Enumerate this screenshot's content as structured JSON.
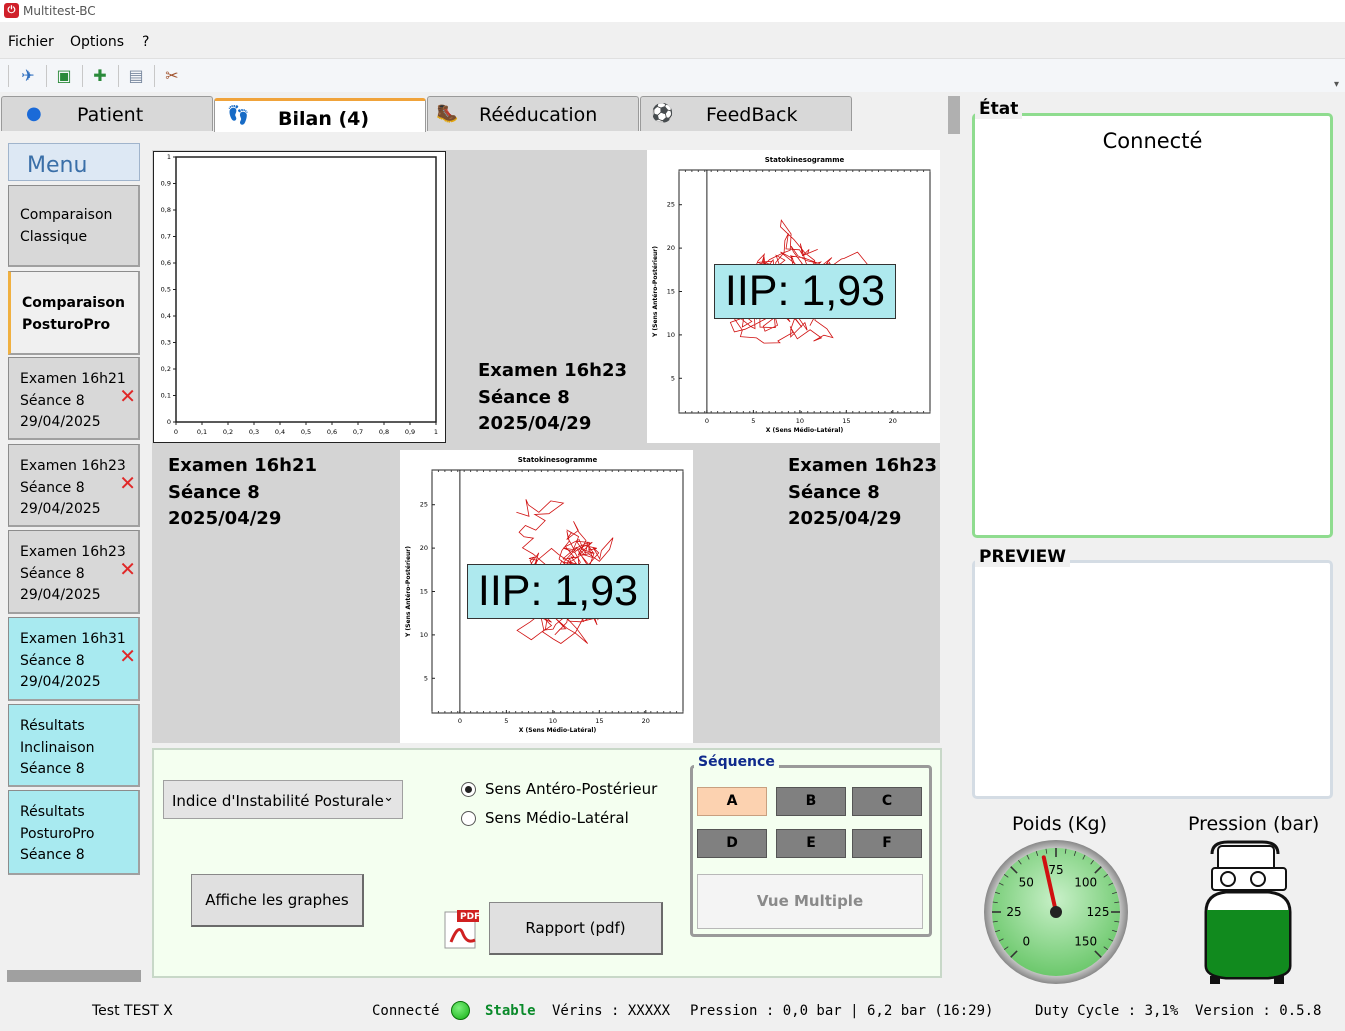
{
  "window": {
    "title": "Multitest-BC"
  },
  "menu": {
    "items": [
      "Fichier",
      "Options",
      "?"
    ]
  },
  "toolbar": {
    "icons": [
      "reset-icon",
      "import-icon",
      "add-patient-icon",
      "open-folder-icon",
      "tools-icon"
    ]
  },
  "tabs": [
    {
      "label": "Patient",
      "icon": "user-icon"
    },
    {
      "label": "Bilan (4)",
      "icon": "feet-icon",
      "active": true
    },
    {
      "label": "Rééducation",
      "icon": "boot-icon"
    },
    {
      "label": "FeedBack",
      "icon": "ball-icon"
    }
  ],
  "sidebar": {
    "title": "Menu",
    "items": [
      {
        "lines": [
          "Comparaison",
          "Classique"
        ],
        "style": "gray"
      },
      {
        "lines": [
          "Comparaison",
          "PosturoPro"
        ],
        "style": "selected"
      },
      {
        "lines": [
          "Examen 16h21",
          "Séance 8",
          "29/04/2025"
        ],
        "style": "gray",
        "delete": true
      },
      {
        "lines": [
          "Examen 16h23",
          "Séance 8",
          "29/04/2025"
        ],
        "style": "gray",
        "delete": true
      },
      {
        "lines": [
          "Examen 16h23",
          "Séance 8",
          "29/04/2025"
        ],
        "style": "gray",
        "delete": true
      },
      {
        "lines": [
          "Examen 16h31",
          "Séance 8",
          "29/04/2025"
        ],
        "style": "cyan",
        "delete": true
      },
      {
        "lines": [
          "Résultats",
          "Inclinaison",
          "Séance 8"
        ],
        "style": "cyan"
      },
      {
        "lines": [
          "Résultats",
          "PosturoPro",
          "Séance 8"
        ],
        "style": "cyan"
      }
    ]
  },
  "grid": {
    "empty_plot": {
      "ticks_x": [
        "0",
        "0,1",
        "0,2",
        "0,3",
        "0,4",
        "0,5",
        "0,6",
        "0,7",
        "0,8",
        "0,9",
        "1"
      ],
      "ticks_y": [
        "1",
        "0,9",
        "0,8",
        "0,7",
        "0,6",
        "0,5",
        "0,4",
        "0,3",
        "0,2",
        "0,1",
        "0"
      ]
    },
    "label_top_mid": {
      "l1": "Examen 16h23",
      "l2": "Séance 8",
      "l3": "2025/04/29"
    },
    "label_bottom_left": {
      "l1": "Examen 16h21",
      "l2": "Séance 8",
      "l3": "2025/04/29"
    },
    "label_bottom_right": {
      "l1": "Examen 16h23",
      "l2": "Séance 8",
      "l3": "2025/04/29"
    },
    "stato_title": "Statokinesogramme",
    "stato_xlabel": "X (Sens Médio-Latéral)",
    "stato_ylabel": "Y (Sens Antéro-Postérieur)",
    "stato_ticks_x": [
      "0",
      "5",
      "10",
      "15",
      "20"
    ],
    "stato_ticks_y": [
      "25",
      "20",
      "15",
      "10",
      "5"
    ],
    "iip_top": "IIP: 1,93",
    "iip_bottom": "IIP: 1,93"
  },
  "controls": {
    "combo_value": "Indice d'Instabilité Posturale",
    "radio_ap": "Sens Antéro-Postérieur",
    "radio_ml": "Sens Médio-Latéral",
    "radio_selected": "ap",
    "show_graphs": "Affiche les graphes",
    "report": "Rapport (pdf)",
    "sequence_title": "Séquence",
    "seq": [
      "A",
      "B",
      "C",
      "D",
      "E",
      "F"
    ],
    "seq_selected": "A",
    "multi_view": "Vue Multiple"
  },
  "right": {
    "etat_title": "État",
    "etat_value": "Connecté",
    "preview_title": "PREVIEW",
    "poids_title": "Poids (Kg)",
    "pression_title": "Pression (bar)",
    "gauge_ticks": [
      "0",
      "25",
      "50",
      "75",
      "100",
      "125",
      "150"
    ],
    "gauge_value": 68,
    "tank_fill": 0.55
  },
  "status": {
    "user": "Test TEST  X",
    "connected": "Connecté",
    "stable": "Stable",
    "verins": "Vérins : XXXXX",
    "pression": "Pression : 0,0 bar | 6,2 bar (16:29)",
    "duty": "Duty Cycle :  3,1%",
    "version": "Version : 0.5.8"
  },
  "colors": {
    "accent_tab": "#f0a33a",
    "cyan": "#a8eaf0",
    "iip_bg": "#aee9ee",
    "etat_border": "#8fdc8f",
    "stable": "#0a8a2a",
    "trace": "#d01010"
  }
}
